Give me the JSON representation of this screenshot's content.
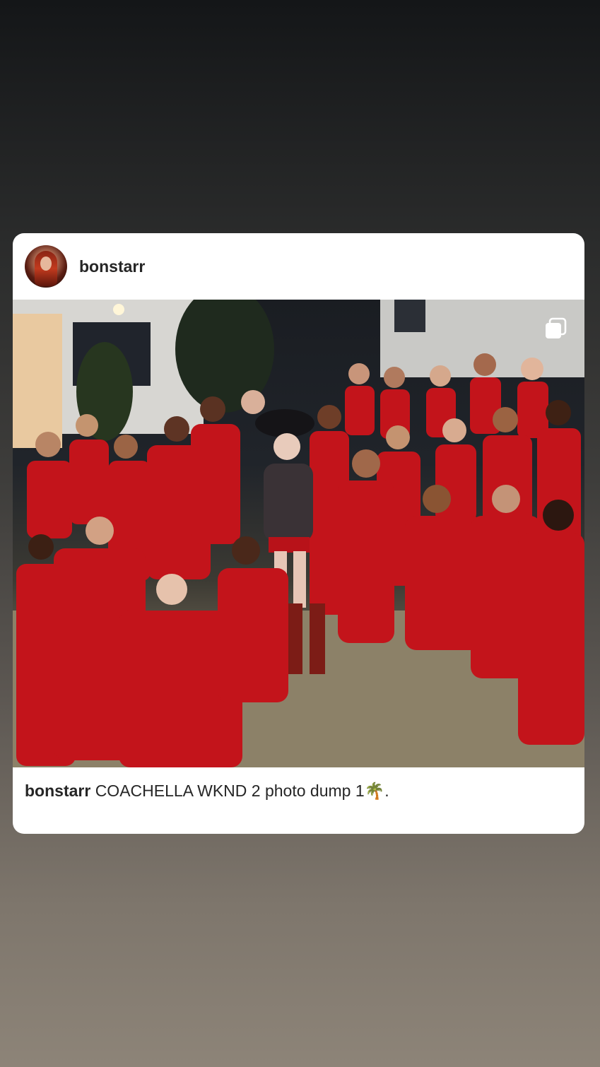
{
  "post": {
    "username": "bonstarr",
    "caption_user": "bonstarr",
    "caption_text": "COACHELLA WKND 2 photo dump 1🌴."
  },
  "icons": {
    "avatar": "profile-avatar",
    "multi_photo": "multi-photo-icon"
  },
  "colors": {
    "card": "#ffffff",
    "text": "#262626",
    "outfit_red": "#c8141a"
  }
}
